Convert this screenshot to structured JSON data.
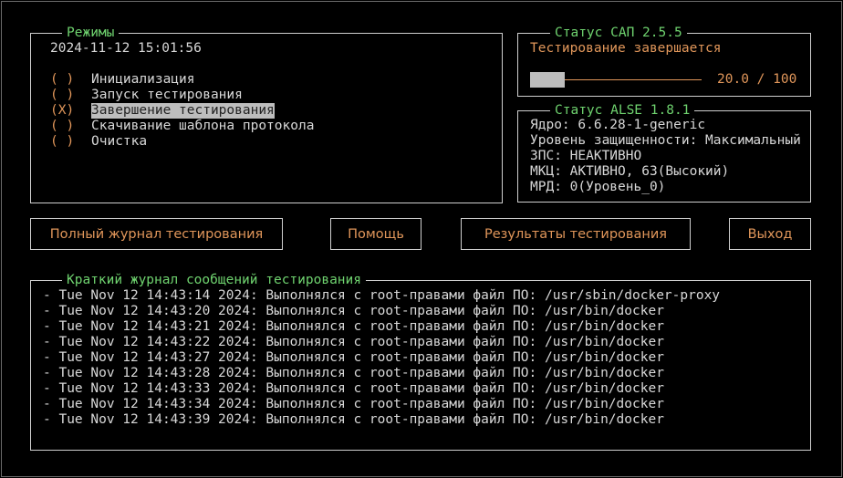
{
  "modes": {
    "title": "Режимы",
    "datetime": "2024-11-12 15:01:56",
    "items": [
      {
        "mark": "( )",
        "label": "Инициализация",
        "selected": false
      },
      {
        "mark": "( )",
        "label": "Запуск тестирования",
        "selected": false
      },
      {
        "mark": "(X)",
        "label": "Завершение тестирования",
        "selected": true
      },
      {
        "mark": "( )",
        "label": "Скачивание шаблона протокола",
        "selected": false
      },
      {
        "mark": "( )",
        "label": "Очистка",
        "selected": false
      }
    ]
  },
  "sap_status": {
    "title": "Статус САП 2.5.5",
    "state": "Тестирование завершается",
    "progress_text": "20.0 / 100",
    "progress_fraction": 0.2
  },
  "alse_status": {
    "title": "Статус ALSE 1.8.1",
    "lines": [
      "Ядро: 6.6.28-1-generic",
      "Уровень защищенности: Максимальный",
      "ЗПС: НЕАКТИВНО",
      "МКЦ: АКТИВНО, 63(Высокий)",
      "МРД: 0(Уровень_0)"
    ]
  },
  "buttons": {
    "full_log": "Полный журнал тестирования",
    "help": "Помощь",
    "results": "Результаты тестирования",
    "exit": "Выход"
  },
  "log": {
    "title": "Краткий журнал сообщений тестирования",
    "lines": [
      "- Tue Nov 12 14:43:14 2024: Выполнялся с root-правами файл ПО: /usr/sbin/docker-proxy",
      "- Tue Nov 12 14:43:20 2024: Выполнялся с root-правами файл ПО: /usr/bin/docker",
      "- Tue Nov 12 14:43:21 2024: Выполнялся с root-правами файл ПО: /usr/bin/docker",
      "- Tue Nov 12 14:43:22 2024: Выполнялся с root-правами файл ПО: /usr/bin/docker",
      "- Tue Nov 12 14:43:27 2024: Выполнялся с root-правами файл ПО: /usr/bin/docker",
      "- Tue Nov 12 14:43:28 2024: Выполнялся с root-правами файл ПО: /usr/bin/docker",
      "- Tue Nov 12 14:43:33 2024: Выполнялся с root-правами файл ПО: /usr/bin/docker",
      "- Tue Nov 12 14:43:34 2024: Выполнялся с root-правами файл ПО: /usr/bin/docker",
      "- Tue Nov 12 14:43:39 2024: Выполнялся с root-правами файл ПО: /usr/bin/docker"
    ]
  },
  "colors": {
    "title_green": "#6fd36f",
    "accent_orange": "#e0965a",
    "selection_gray": "#bdbdbd"
  }
}
